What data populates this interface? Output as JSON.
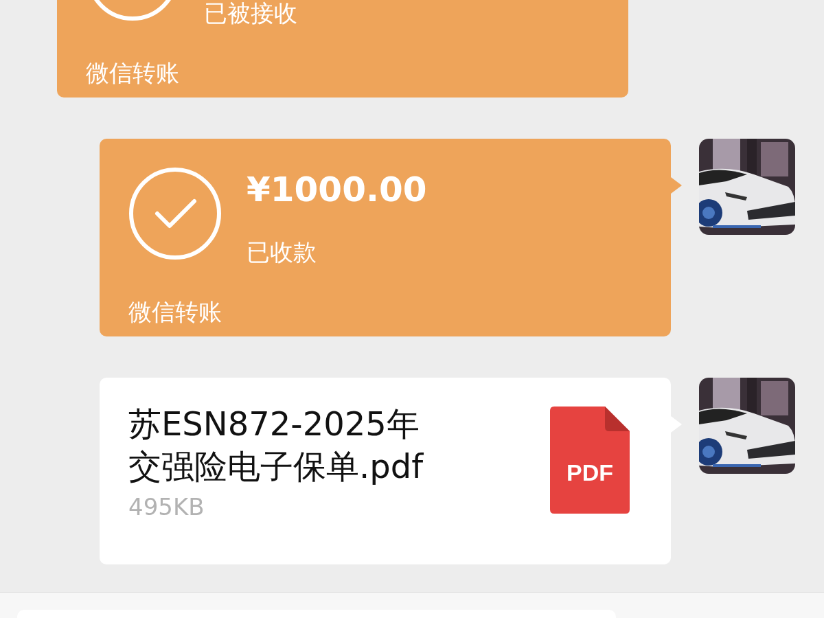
{
  "messages": [
    {
      "kind": "transfer",
      "outgoing": false,
      "received": true,
      "status": "已被接收",
      "footer": "微信转账"
    },
    {
      "kind": "transfer",
      "outgoing": true,
      "received": true,
      "amount": "¥1000.00",
      "status": "已收款",
      "footer": "微信转账"
    },
    {
      "kind": "file",
      "outgoing": true,
      "name_lines": [
        "苏ESN872-2025年",
        "交强险电子保单.pdf"
      ],
      "size": "495KB",
      "file_type": "PDF"
    }
  ],
  "input_bar": {
    "kind": "text"
  }
}
